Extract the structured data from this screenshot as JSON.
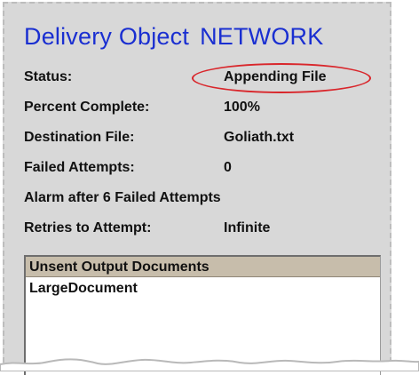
{
  "title": {
    "prefix": "Delivery Object",
    "name": "NETWORK"
  },
  "fields": [
    {
      "label": "Status:",
      "value": "Appending File"
    },
    {
      "label": "Percent Complete:",
      "value": "100%"
    },
    {
      "label": "Destination File:",
      "value": "Goliath.txt"
    },
    {
      "label": "Failed Attempts:",
      "value": "0"
    },
    {
      "label": "Alarm after 6 Failed Attempts",
      "value": ""
    },
    {
      "label": "Retries to Attempt:",
      "value": "Infinite"
    }
  ],
  "documents": {
    "header": "Unsent Output Documents",
    "items": [
      "LargeDocument"
    ]
  },
  "colors": {
    "title": "#1a2fd1",
    "highlight_circle": "#d9262b",
    "list_header": "#c7bdab",
    "panel": "#d8d8d8"
  }
}
